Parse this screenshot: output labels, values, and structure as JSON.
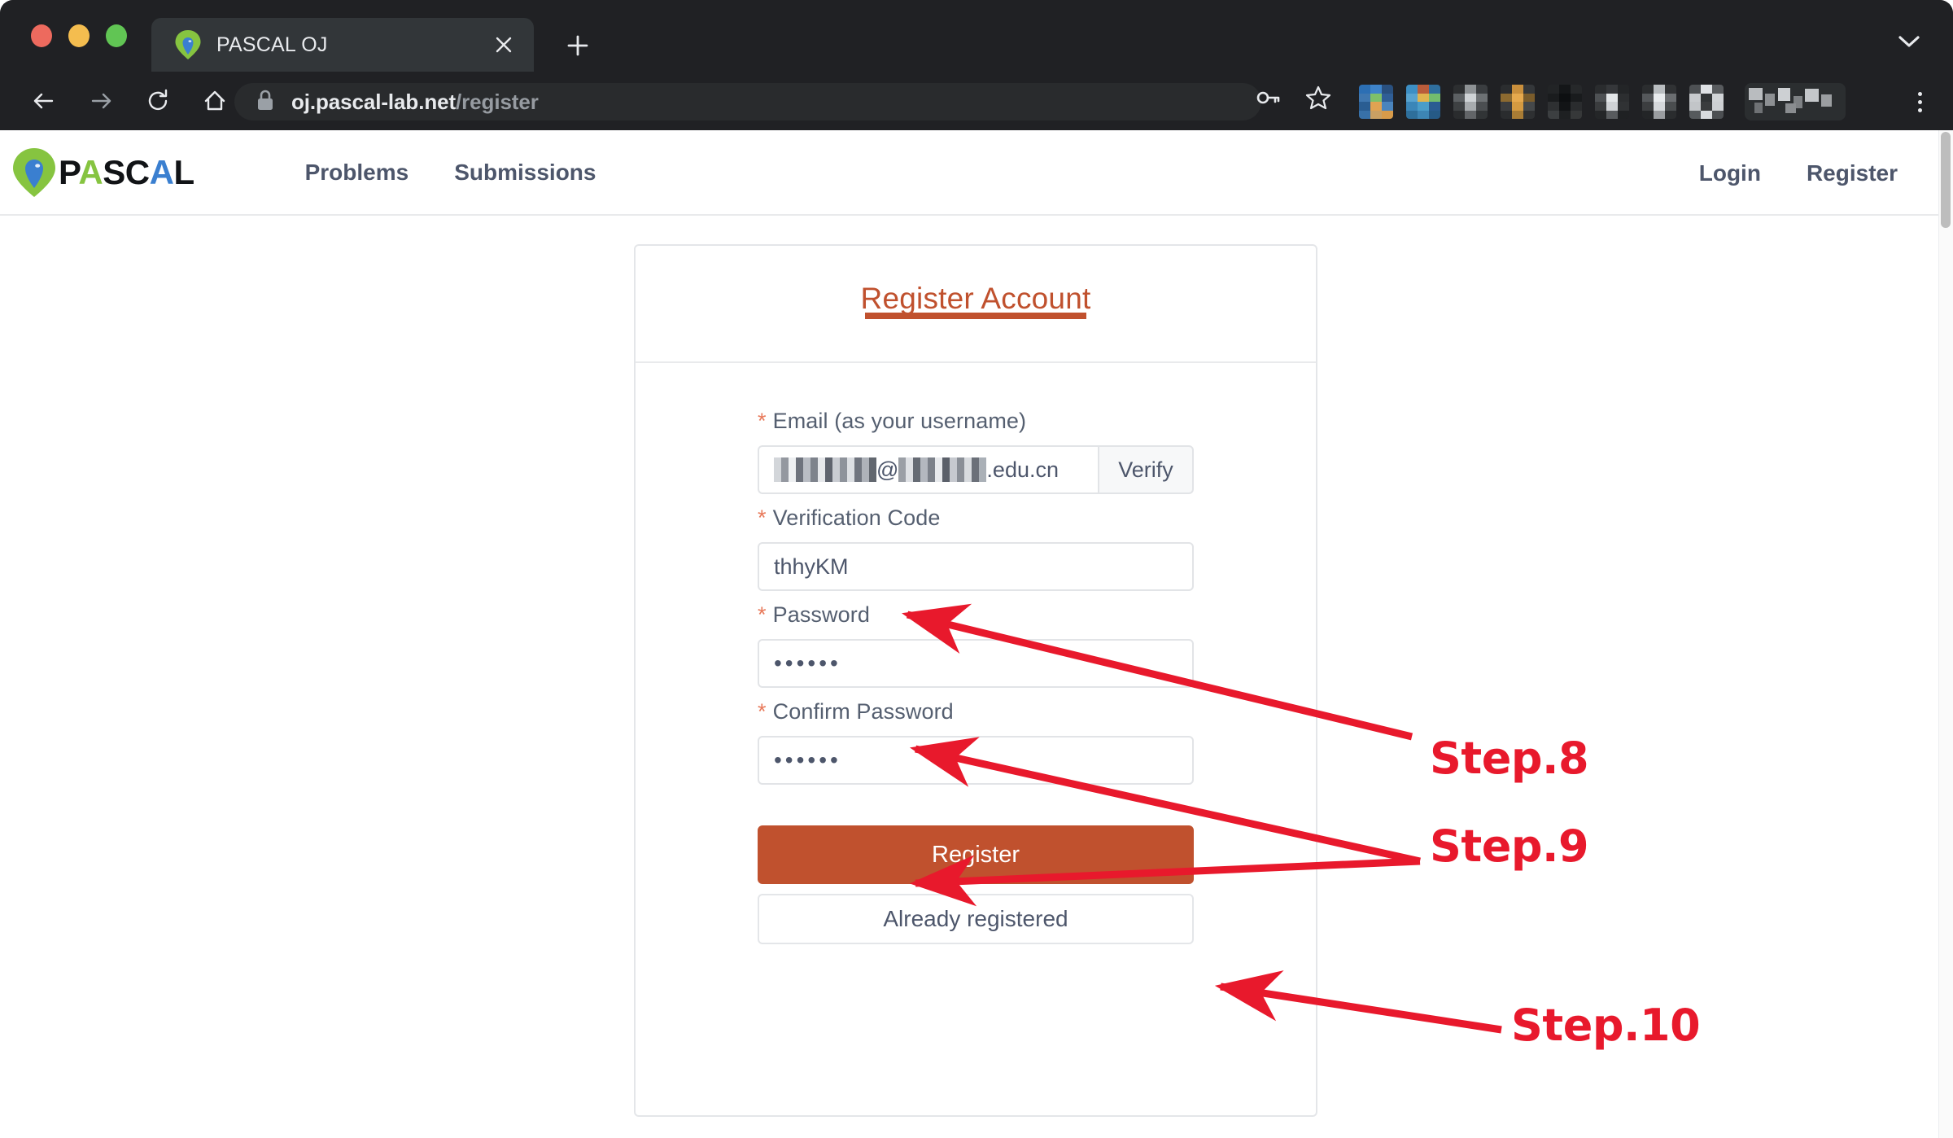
{
  "browser": {
    "window_controls": [
      "close",
      "minimize",
      "maximize"
    ],
    "tab": {
      "title": "PASCAL OJ",
      "favicon": "pascal-pin-icon",
      "close_label": "×"
    },
    "new_tab_label": "+",
    "tab_search_icon": "chevron-down-icon",
    "toolbar": {
      "back_icon": "arrow-left-icon",
      "forward_icon": "arrow-right-icon",
      "reload_icon": "reload-icon",
      "home_icon": "home-icon",
      "lock_icon": "lock-icon",
      "url_host": "oj.pascal-lab.net",
      "url_path": "/register",
      "password_key_icon": "key-icon",
      "bookmark_icon": "star-icon",
      "menu_icon": "kebab-menu-icon",
      "extension_count": 8
    }
  },
  "site": {
    "brand": {
      "logo_icon": "pascal-pin-icon",
      "letters": [
        {
          "ch": "P",
          "color": "#111316"
        },
        {
          "ch": "A",
          "color": "#86c440"
        },
        {
          "ch": "S",
          "color": "#111316"
        },
        {
          "ch": "C",
          "color": "#111316"
        },
        {
          "ch": "A",
          "color": "#3a7fd0"
        },
        {
          "ch": "L",
          "color": "#111316"
        }
      ]
    },
    "nav_main": [
      {
        "label": "Problems"
      },
      {
        "label": "Submissions"
      }
    ],
    "nav_right": [
      {
        "label": "Login"
      },
      {
        "label": "Register"
      }
    ]
  },
  "card": {
    "tab_title": "Register Account",
    "accent_color": "#c0512e",
    "fields": [
      {
        "id": "email",
        "label": "Email (as your username)",
        "required_mark": "*",
        "value_redacted": true,
        "value_suffix": ".edu.cn",
        "value_separator": "@",
        "button": "Verify"
      },
      {
        "id": "verification_code",
        "label": "Verification Code",
        "required_mark": "*",
        "value": "thhyKM"
      },
      {
        "id": "password",
        "label": "Password",
        "required_mark": "*",
        "value_masked": "••••••"
      },
      {
        "id": "confirm_password",
        "label": "Confirm Password",
        "required_mark": "*",
        "value_masked": "••••••"
      }
    ],
    "primary_button": "Register",
    "secondary_button": "Already registered"
  },
  "annotations": {
    "color": "#e8192c",
    "steps": [
      {
        "label": "Step.8",
        "target": "verification-code-input"
      },
      {
        "label": "Step.9",
        "target": "password-and-confirm-password-inputs"
      },
      {
        "label": "Step.10",
        "target": "register-button"
      }
    ]
  }
}
